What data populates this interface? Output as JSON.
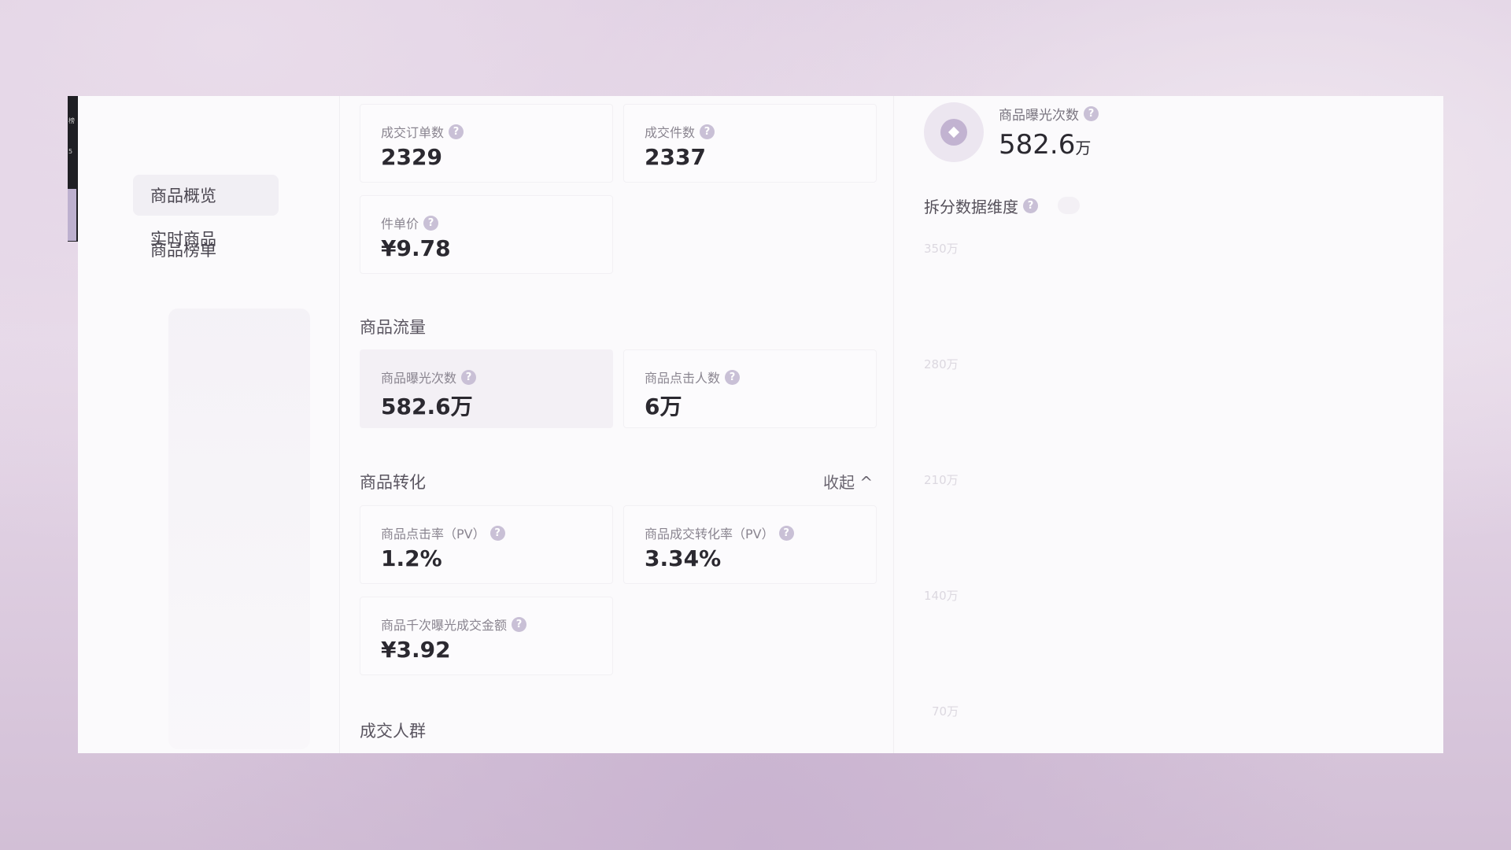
{
  "sidebar": {
    "items": [
      {
        "label": "实时商品",
        "active": false
      },
      {
        "label": "商品概览",
        "active": true
      },
      {
        "label": "商品榜单",
        "active": false
      }
    ]
  },
  "cards": {
    "orders": {
      "label": "成交订单数",
      "value": "2329"
    },
    "items_sold": {
      "label": "成交件数",
      "value": "2337"
    },
    "unit_price": {
      "label": "件单价",
      "value": "¥9.78"
    },
    "exposure": {
      "label": "商品曝光次数",
      "value": "582.6万"
    },
    "clicks": {
      "label": "商品点击人数",
      "value": "6万"
    },
    "ctr": {
      "label": "商品点击率（PV）",
      "value": "1.2%"
    },
    "cvr": {
      "label": "商品成交转化率（PV）",
      "value": "3.34%"
    },
    "gmv_per_k": {
      "label": "商品千次曝光成交金额",
      "value": "¥3.92"
    }
  },
  "sections": {
    "traffic": "商品流量",
    "conversion": "商品转化",
    "collapse": "收起",
    "buyers": "成交人群"
  },
  "right_panel": {
    "metric_label": "商品曝光次数",
    "metric_value": "582.6",
    "metric_unit": "万",
    "dimension_label": "拆分数据维度",
    "y_ticks": [
      "350万",
      "280万",
      "210万",
      "140万",
      "70万"
    ]
  },
  "colors": {
    "accent": "#c2b3d1",
    "highlight_card": "#f3f0f5"
  }
}
